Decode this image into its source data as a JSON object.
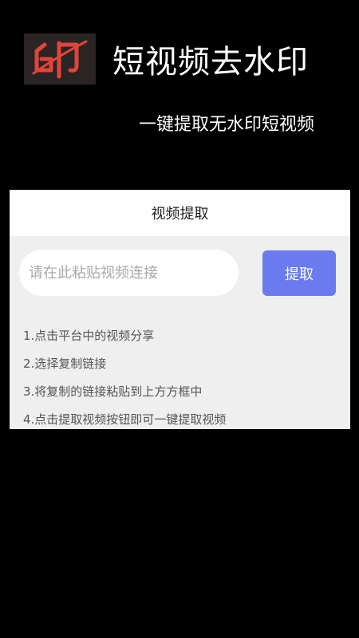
{
  "header": {
    "logo_text": "印",
    "app_title": "短视频去水印",
    "subtitle": "一键提取无水印短视频"
  },
  "panel": {
    "title": "视频提取",
    "input": {
      "value": "",
      "placeholder": "请在此粘贴视频连接"
    },
    "extract_button_label": "提取",
    "steps": [
      "1.点击平台中的视频分享",
      "2.选择复制链接",
      "3.将复制的链接粘贴到上方方框中",
      "4.点击提取视频按钮即可一键提取视频"
    ]
  },
  "colors": {
    "background": "#000000",
    "panel_background": "#efefef",
    "accent": "#6a7bef",
    "logo_red": "#e0453a"
  }
}
